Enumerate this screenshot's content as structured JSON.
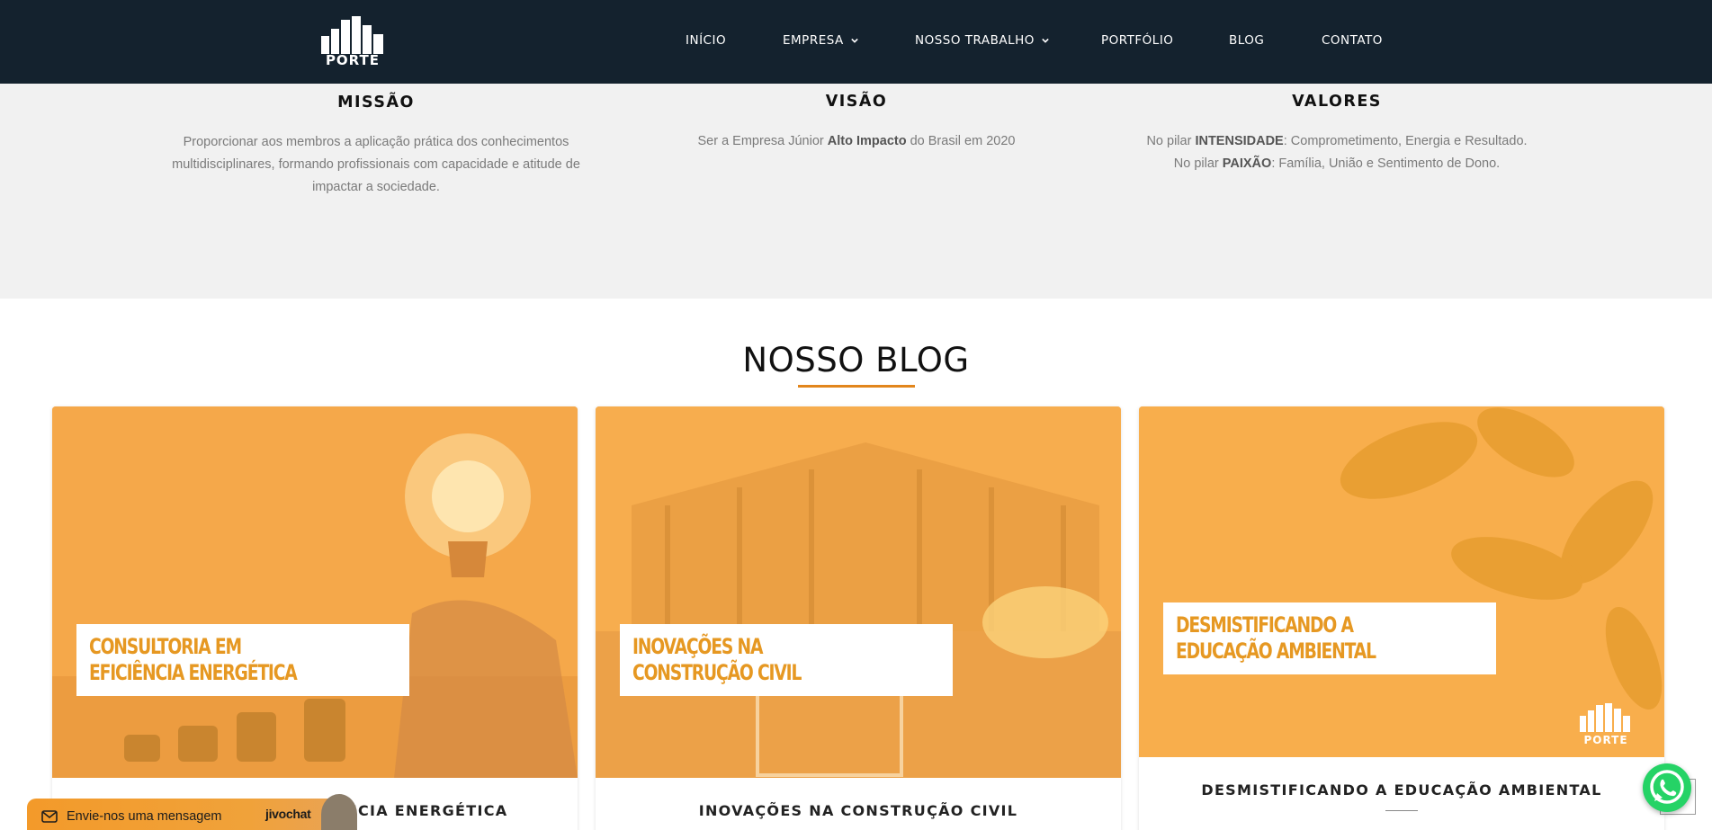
{
  "header": {
    "logo_text": "PORTE",
    "nav": [
      {
        "label": "INÍCIO",
        "has_dropdown": false
      },
      {
        "label": "EMPRESA",
        "has_dropdown": true
      },
      {
        "label": "NOSSO TRABALHO",
        "has_dropdown": true
      },
      {
        "label": "PORTFÓLIO",
        "has_dropdown": false
      },
      {
        "label": "BLOG",
        "has_dropdown": false
      },
      {
        "label": "CONTATO",
        "has_dropdown": false
      }
    ]
  },
  "mvv": {
    "missao": {
      "title": "MISSÃO",
      "lines": [
        "Proporcionar aos membros a aplicação prática dos conhecimentos",
        "multidisciplinares, formando profissionais com capacidade e atitude de",
        "impactar a sociedade."
      ]
    },
    "visao": {
      "title": "VISÃO",
      "prefix": "Ser a Empresa Júnior ",
      "bold": "Alto Impacto",
      "suffix": " do Brasil em 2020"
    },
    "valores": {
      "title": "VALORES",
      "line1_prefix": "No pilar ",
      "line1_bold": "INTENSIDADE",
      "line1_suffix": ": Comprometimento, Energia e Resultado.",
      "line2_prefix": "No pilar ",
      "line2_bold": "PAIXÃO",
      "line2_suffix": ": Família, União e Sentimento de Dono."
    }
  },
  "blog": {
    "title": "NOSSO BLOG",
    "posts": [
      {
        "label_line1": "CONSULTORIA EM",
        "label_line2": "EFICIÊNCIA ENERGÉTICA",
        "title": "CONSULTORIA EM EFICIÊNCIA ENERGÉTICA"
      },
      {
        "label_line1": "INOVAÇÕES NA",
        "label_line2": "CONSTRUÇÃO CIVIL",
        "title": "INOVAÇÕES NA CONSTRUÇÃO CIVIL"
      },
      {
        "label_line1": "DESMISTIFICANDO A",
        "label_line2": "EDUCAÇÃO AMBIENTAL",
        "title": "DESMISTIFICANDO A EDUCAÇÃO AMBIENTAL",
        "logo_text": "PORTE"
      }
    ]
  },
  "chat": {
    "message": "Envie-nos uma mensagem",
    "brand": "jivochat"
  },
  "colors": {
    "header_bg": "#14222e",
    "accent": "#e2861c",
    "card_overlay": "#f6ac4b",
    "whatsapp": "#25d366"
  }
}
